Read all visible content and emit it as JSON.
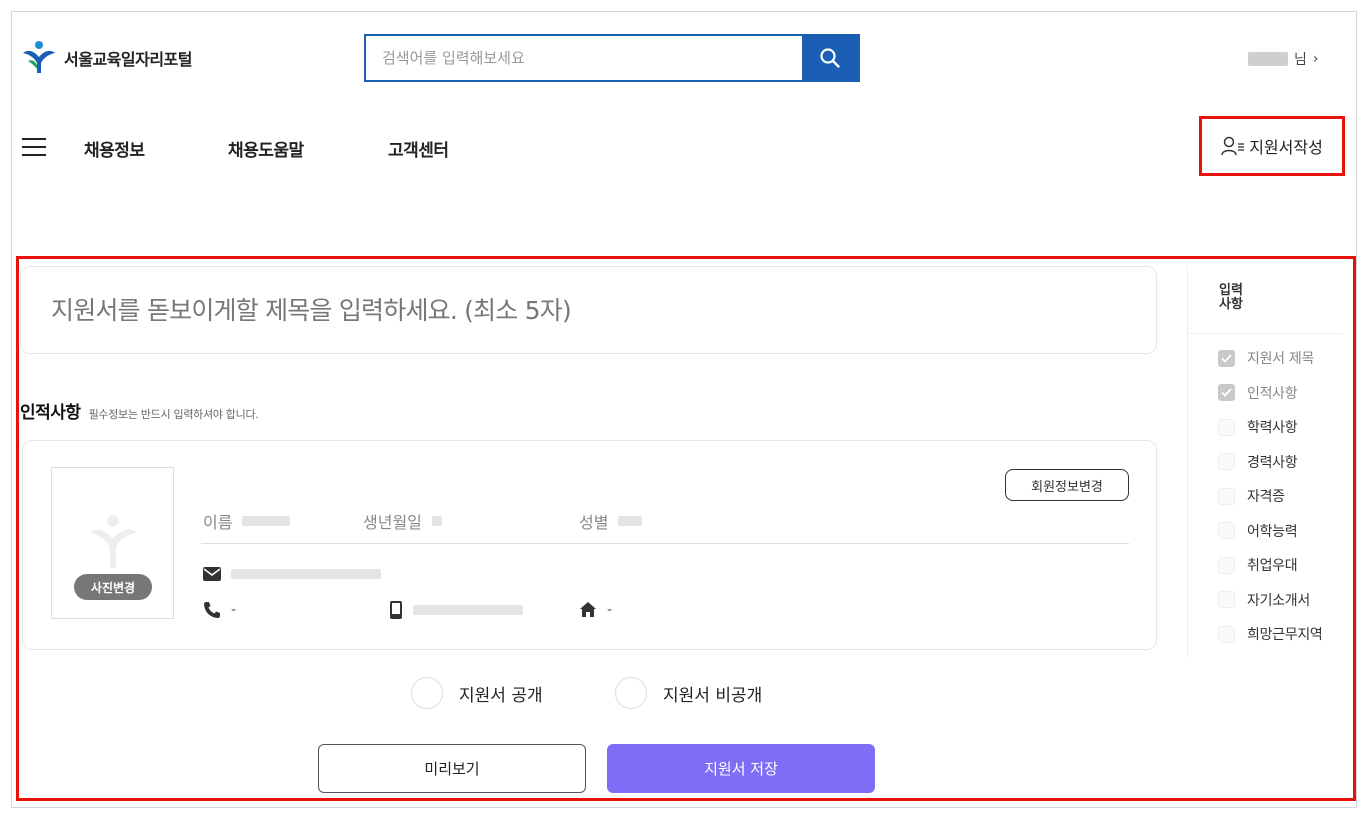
{
  "header": {
    "logo_text": "서울교육일자리포털",
    "search_placeholder": "검색어를 입력해보세요",
    "user_suffix": "님",
    "user_chevron": "›"
  },
  "nav": {
    "items": [
      "채용정보",
      "채용도움말",
      "고객센터"
    ],
    "resume_button": "지원서작성"
  },
  "form": {
    "title_placeholder": "지원서를 돋보이게할 제목을 입력하세요. (최소 5자)",
    "section_title": "인적사항",
    "section_note": "필수정보는 반드시 입력하셔야 합니다.",
    "photo_button": "사진변경",
    "member_button": "회원정보변경",
    "name_label": "이름",
    "birth_label": "생년월일",
    "gender_label": "성별",
    "phone_dash": "-",
    "address_dash": "-",
    "public_label": "지원서 공개",
    "private_label": "지원서 비공개",
    "preview_button": "미리보기",
    "save_button": "지원서 저장"
  },
  "side_panel": {
    "title": "입력사항",
    "items": [
      {
        "label": "지원서 제목",
        "checked": true
      },
      {
        "label": "인적사항",
        "checked": true
      },
      {
        "label": "학력사항",
        "checked": false
      },
      {
        "label": "경력사항",
        "checked": false
      },
      {
        "label": "자격증",
        "checked": false
      },
      {
        "label": "어학능력",
        "checked": false
      },
      {
        "label": "취업우대",
        "checked": false
      },
      {
        "label": "자기소개서",
        "checked": false
      },
      {
        "label": "희망근무지역",
        "checked": false
      }
    ]
  },
  "colors": {
    "search_blue": "#1b5fb5",
    "highlight_red": "#e8120c",
    "save_purple": "#7d6ef5"
  }
}
